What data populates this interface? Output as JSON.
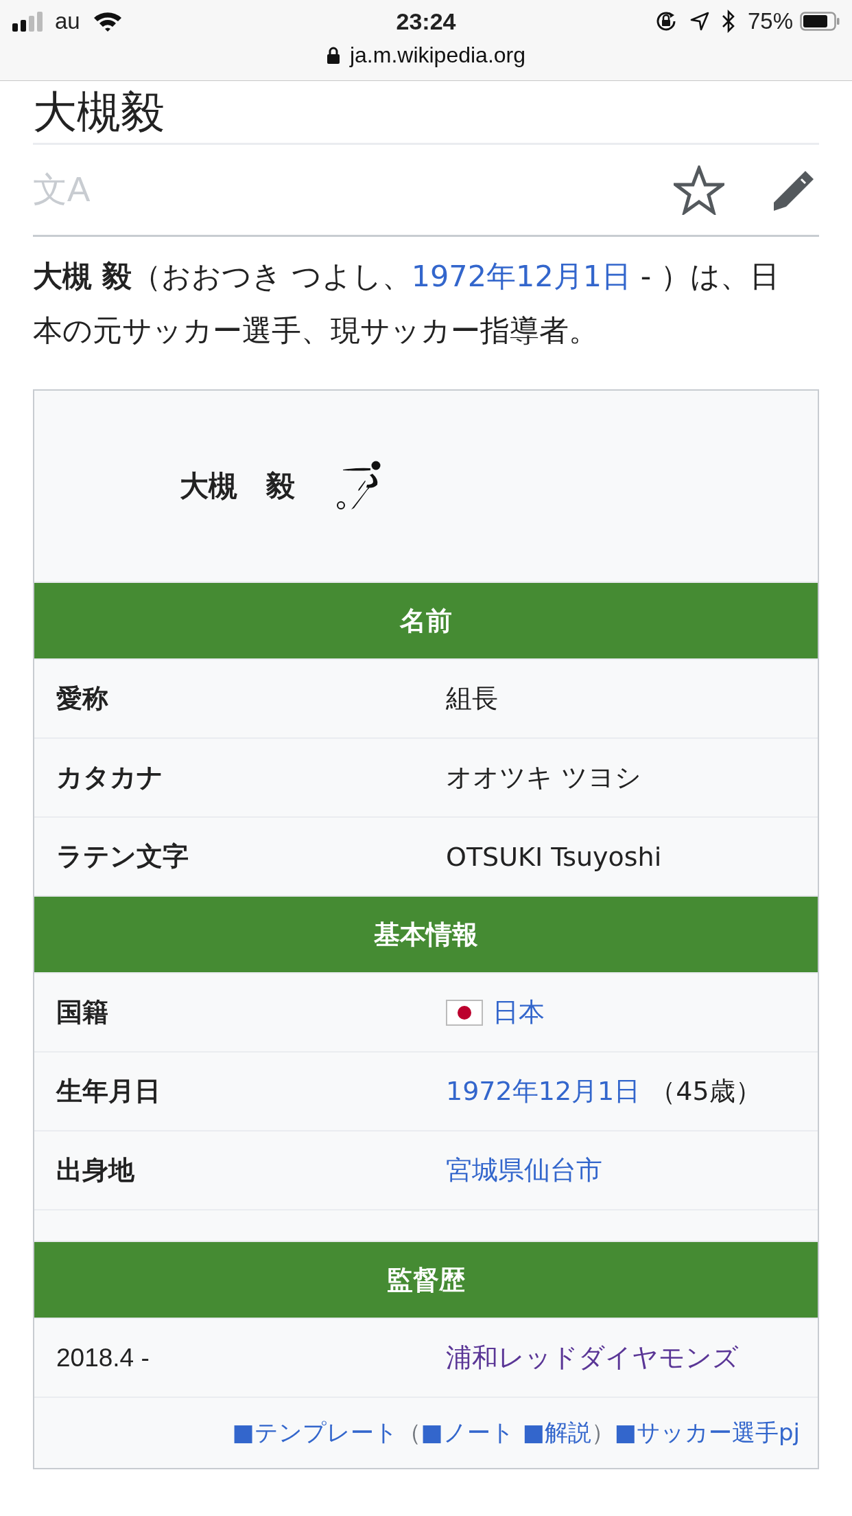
{
  "status_bar": {
    "carrier": "au",
    "time": "23:24",
    "battery": "75%",
    "url": "ja.m.wikipedia.org"
  },
  "page": {
    "title": "大槻毅",
    "language_button": "文A",
    "lead": [
      {
        "kind": "bold",
        "text": "大槻 毅"
      },
      {
        "kind": "text",
        "text": "（おおつき つよし、"
      },
      {
        "kind": "link",
        "text": "1972年12月1日"
      },
      {
        "kind": "text",
        "text": " - ）は、日本の元サッカー選手、現サッカー指導者。"
      }
    ]
  },
  "infobox": {
    "title": "大槻　毅",
    "sections": [
      {
        "heading": "名前",
        "rows": [
          {
            "label": "愛称",
            "values": [
              {
                "kind": "text",
                "text": "組長"
              }
            ]
          },
          {
            "label": "カタカナ",
            "values": [
              {
                "kind": "text",
                "text": "オオツキ ツヨシ"
              }
            ]
          },
          {
            "label": "ラテン文字",
            "values": [
              {
                "kind": "text",
                "text": "OTSUKI Tsuyoshi"
              }
            ]
          }
        ]
      },
      {
        "heading": "基本情報",
        "rows": [
          {
            "label": "国籍",
            "values": [
              {
                "kind": "flag"
              },
              {
                "kind": "link",
                "text": "日本"
              }
            ]
          },
          {
            "label": "生年月日",
            "values": [
              {
                "kind": "link",
                "text": "1972年12月1日"
              },
              {
                "kind": "text",
                "text": "（45歳）"
              }
            ]
          },
          {
            "label": "出身地",
            "values": [
              {
                "kind": "link",
                "text": "宮城県仙台市"
              }
            ]
          },
          {
            "kind": "blank"
          }
        ]
      },
      {
        "heading": "監督歴",
        "rows": [
          {
            "label": "2018.4 -",
            "label_bold": false,
            "values": [
              {
                "kind": "visited",
                "text": "浦和レッドダイヤモンズ"
              }
            ]
          }
        ]
      }
    ],
    "footer": [
      {
        "kind": "link",
        "text": "■テンプレート"
      },
      {
        "kind": "text",
        "text": "（"
      },
      {
        "kind": "link",
        "text": "■ノート"
      },
      {
        "kind": "link",
        "text": "■解説"
      },
      {
        "kind": "text",
        "text": "）"
      },
      {
        "kind": "link",
        "text": "■サッカー選手pj"
      }
    ]
  }
}
